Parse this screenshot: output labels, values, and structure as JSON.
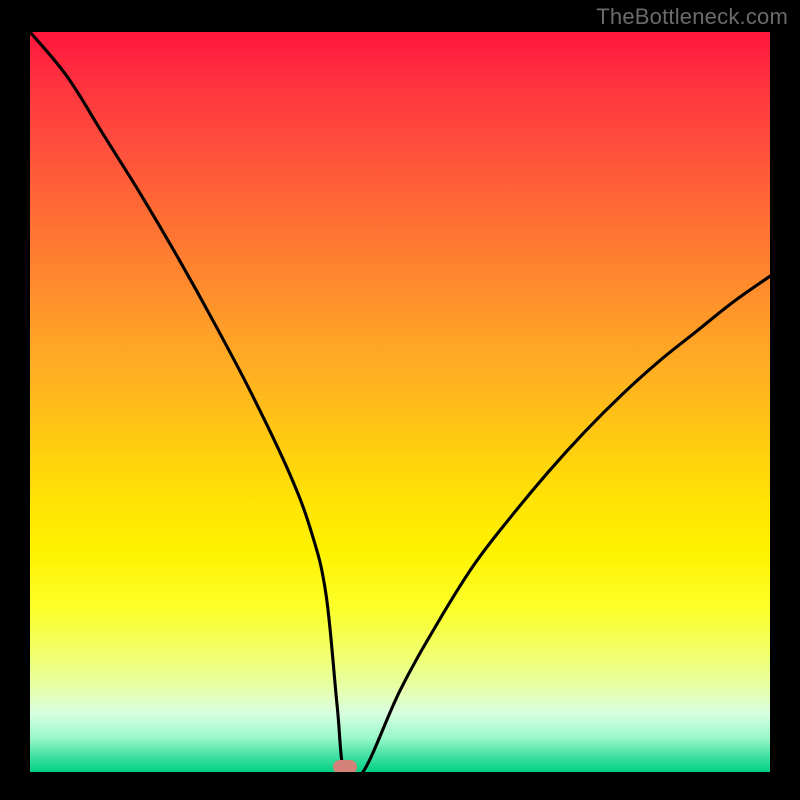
{
  "watermark": "TheBottleneck.com",
  "chart_data": {
    "type": "line",
    "title": "",
    "xlabel": "",
    "ylabel": "",
    "ylim": [
      0,
      100
    ],
    "x": [
      0,
      5,
      10,
      15,
      20,
      25,
      30,
      35,
      38,
      40,
      41.5,
      42.5,
      45,
      50,
      55,
      60,
      65,
      70,
      75,
      80,
      85,
      90,
      95,
      100
    ],
    "values": [
      100,
      94,
      86,
      78,
      69.5,
      60.5,
      51,
      40.5,
      32.5,
      24,
      9,
      0,
      0,
      11,
      20,
      28,
      34.5,
      40.5,
      46,
      51,
      55.5,
      59.5,
      63.5,
      67
    ],
    "marker": {
      "x": 42.5,
      "y": 0
    },
    "gradient": {
      "top": "#ff163c",
      "bottom": "#00d184"
    }
  }
}
